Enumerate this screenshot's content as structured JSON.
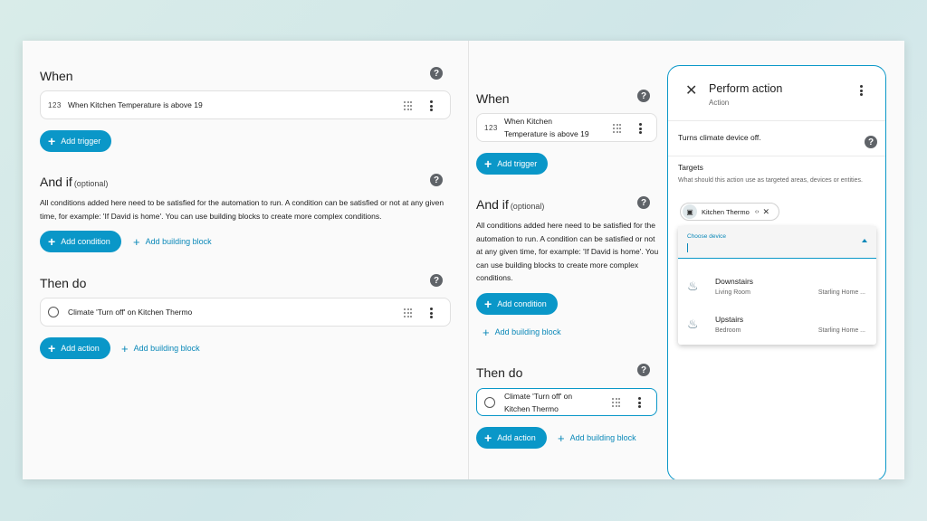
{
  "left": {
    "when": {
      "title": "When",
      "trigger_icon": "123",
      "trigger_text": "When Kitchen Temperature is above 19",
      "add_trigger": "Add trigger"
    },
    "and_if": {
      "title": "And if",
      "optional": "(optional)",
      "description": "All conditions added here need to be satisfied for the automation to run. A condition can be satisfied or not at any given time, for example: 'If David is home'. You can use building blocks to create more complex conditions.",
      "add_condition": "Add condition",
      "add_building_block": "Add building block"
    },
    "then_do": {
      "title": "Then do",
      "action_text": "Climate 'Turn off' on Kitchen Thermo",
      "add_action": "Add action",
      "add_building_block": "Add building block"
    }
  },
  "middle": {
    "when": {
      "title": "When",
      "trigger_icon": "123",
      "trigger_line1": "When Kitchen",
      "trigger_line2": "Temperature is above 19",
      "add_trigger": "Add trigger"
    },
    "and_if": {
      "title": "And if",
      "optional": "(optional)",
      "description": "All conditions added here need to be satisfied for the automation to run. A condition can be satisfied or not at any given time, for example: 'If David is home'. You can use building blocks to create more complex conditions.",
      "add_condition": "Add condition",
      "add_building_block": "Add building block"
    },
    "then_do": {
      "title": "Then do",
      "action_line1": "Climate 'Turn off' on",
      "action_line2": "Kitchen Thermo",
      "add_action": "Add action",
      "add_building_block": "Add building block"
    }
  },
  "dialog": {
    "title": "Perform action",
    "subtitle": "Action",
    "description": "Turns climate device off.",
    "targets_label": "Targets",
    "targets_hint": "What should this action use as targeted areas, devices or entities.",
    "chip_label": "Kitchen Thermo",
    "chip_code": "‹›",
    "dropdown": {
      "label": "Choose device",
      "items": [
        {
          "name": "Downstairs",
          "area": "Living Room",
          "home": "Starling Home ..."
        },
        {
          "name": "Upstairs",
          "area": "Bedroom",
          "home": "Starling Home ..."
        }
      ]
    }
  },
  "colors": {
    "accent": "#0a97c8",
    "background": "#fafafa"
  }
}
